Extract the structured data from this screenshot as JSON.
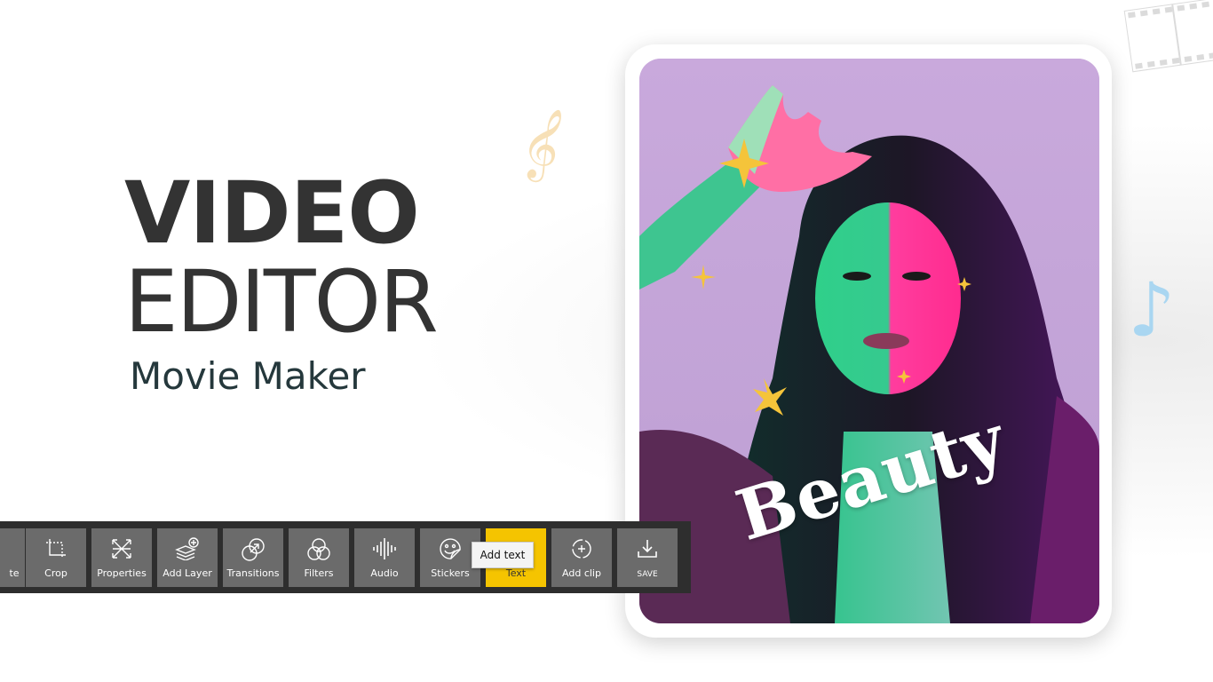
{
  "headline": {
    "line1": "VIDEO",
    "line2": "EDITOR",
    "line3": "Movie Maker"
  },
  "preview": {
    "overlay_text": "Beauty",
    "sticker_icons": [
      "sparkle-icon",
      "star-icon"
    ]
  },
  "decorations": {
    "treble_clef": "𝄞",
    "music_note": "♪",
    "film_strip": "film-strip-icon"
  },
  "toolbar": {
    "items": [
      {
        "label": "te",
        "icon": "rotate-icon"
      },
      {
        "label": "Crop",
        "icon": "crop-icon"
      },
      {
        "label": "Properties",
        "icon": "properties-icon"
      },
      {
        "label": "Add Layer",
        "icon": "add-layer-icon"
      },
      {
        "label": "Transitions",
        "icon": "transitions-icon"
      },
      {
        "label": "Filters",
        "icon": "filters-icon"
      },
      {
        "label": "Audio",
        "icon": "audio-icon"
      },
      {
        "label": "Stickers",
        "icon": "stickers-icon"
      },
      {
        "label": "Text",
        "icon": "text-icon",
        "active": true
      },
      {
        "label": "Add clip",
        "icon": "add-clip-icon"
      },
      {
        "label": "SAVE",
        "icon": "save-icon"
      }
    ],
    "tooltip": "Add text",
    "active_color": "#f5c400",
    "button_color": "#6b6b6b",
    "bar_color": "#2e2e2e"
  }
}
